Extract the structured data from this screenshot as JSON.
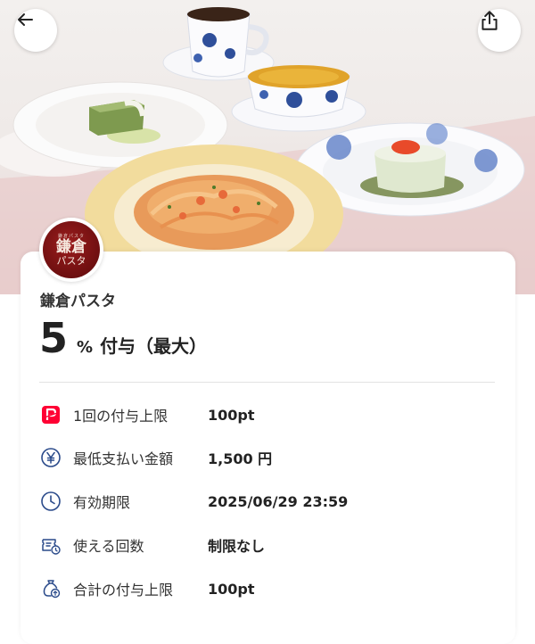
{
  "header": {
    "back_icon": "back-arrow-icon",
    "share_icon": "share-icon"
  },
  "store": {
    "logo_small": "鎌倉パスタ",
    "logo_main": "鎌倉",
    "logo_sub": "パスタ",
    "name": "鎌倉パスタ"
  },
  "reward": {
    "rate": "5",
    "percent_symbol": "%",
    "label": "付与（最大）"
  },
  "details": [
    {
      "icon": "paypay-icon",
      "label": "1回の付与上限",
      "value": "100pt"
    },
    {
      "icon": "yen-icon",
      "label": "最低支払い金額",
      "value": "1,500  円"
    },
    {
      "icon": "clock-icon",
      "label": "有効期限",
      "value": "2025/06/29 23:59"
    },
    {
      "icon": "usage-count-icon",
      "label": "使える回数",
      "value": "制限なし"
    },
    {
      "icon": "coin-bag-icon",
      "label": "合計の付与上限",
      "value": "100pt"
    }
  ],
  "colors": {
    "paypay_red": "#ff0033",
    "icon_blue": "#2a4a8a",
    "logo_red": "#7a1314"
  }
}
